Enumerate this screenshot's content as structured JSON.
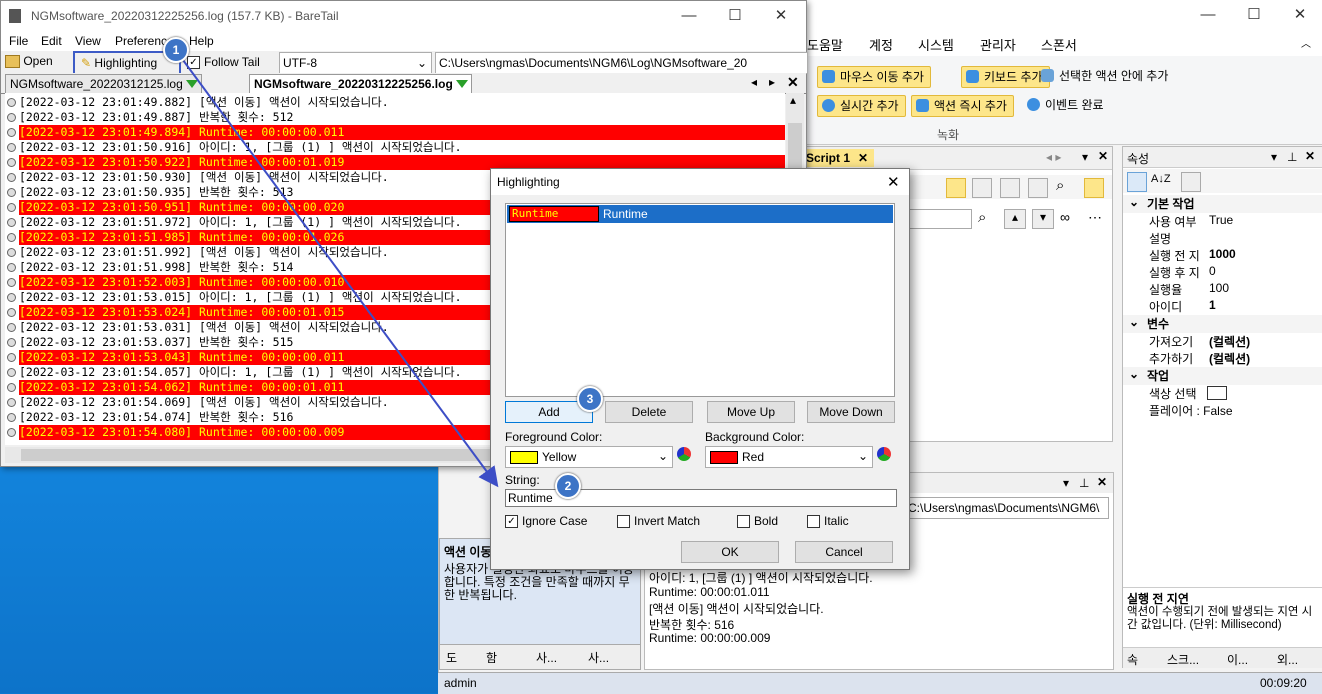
{
  "bt": {
    "title": "NGMsoftware_20220312225256.log (157.7 KB) - BareTail",
    "menu": [
      "File",
      "Edit",
      "View",
      "Preferences",
      "Help"
    ],
    "toolbar": {
      "open": "Open",
      "highlighting": "Highlighting",
      "follow_tail": "Follow Tail",
      "encoding": "UTF-8",
      "path": "C:\\Users\\ngmas\\Documents\\NGM6\\Log\\NGMsoftware_20"
    },
    "tabs": [
      "NGMsoftware_20220312125.log",
      "NGMsoftware_20220312225256.log"
    ],
    "lines": [
      {
        "t": "[2022-03-12 23:01:49.882] [액션 이동] 액션이 시작되었습니다.",
        "hl": false
      },
      {
        "t": "[2022-03-12 23:01:49.887] 반복한 횟수: 512",
        "hl": false
      },
      {
        "t": "[2022-03-12 23:01:49.894] Runtime: 00:00:00.011",
        "hl": true
      },
      {
        "t": "[2022-03-12 23:01:50.916] 아이디: 1, [그룹 (1) ] 액션이 시작되었습니다.",
        "hl": false
      },
      {
        "t": "[2022-03-12 23:01:50.922] Runtime: 00:00:01.019",
        "hl": true
      },
      {
        "t": "[2022-03-12 23:01:50.930] [액션 이동] 액션이 시작되었습니다.",
        "hl": false
      },
      {
        "t": "[2022-03-12 23:01:50.935] 반복한 횟수: 513",
        "hl": false
      },
      {
        "t": "[2022-03-12 23:01:50.951] Runtime: 00:00:00.020",
        "hl": true
      },
      {
        "t": "[2022-03-12 23:01:51.972] 아이디: 1, [그룹 (1) ] 액션이 시작되었습니다.",
        "hl": false
      },
      {
        "t": "[2022-03-12 23:01:51.985] Runtime: 00:00:01.026",
        "hl": true
      },
      {
        "t": "[2022-03-12 23:01:51.992] [액션 이동] 액션이 시작되었습니다.",
        "hl": false
      },
      {
        "t": "[2022-03-12 23:01:51.998] 반복한 횟수: 514",
        "hl": false
      },
      {
        "t": "[2022-03-12 23:01:52.003] Runtime: 00:00:00.010",
        "hl": true
      },
      {
        "t": "[2022-03-12 23:01:53.015] 아이디: 1, [그룹 (1) ] 액션이 시작되었습니다.",
        "hl": false
      },
      {
        "t": "[2022-03-12 23:01:53.024] Runtime: 00:00:01.015",
        "hl": true
      },
      {
        "t": "[2022-03-12 23:01:53.031] [액션 이동] 액션이 시작되었습니다.",
        "hl": false
      },
      {
        "t": "[2022-03-12 23:01:53.037] 반복한 횟수: 515",
        "hl": false
      },
      {
        "t": "[2022-03-12 23:01:53.043] Runtime: 00:00:00.011",
        "hl": true
      },
      {
        "t": "[2022-03-12 23:01:54.057] 아이디: 1, [그룹 (1) ] 액션이 시작되었습니다.",
        "hl": false
      },
      {
        "t": "[2022-03-12 23:01:54.062] Runtime: 00:00:01.011",
        "hl": true
      },
      {
        "t": "[2022-03-12 23:01:54.069] [액션 이동] 액션이 시작되었습니다.",
        "hl": false
      },
      {
        "t": "[2022-03-12 23:01:54.074] 반복한 횟수: 516",
        "hl": false
      },
      {
        "t": "[2022-03-12 23:01:54.080] Runtime: 00:00:00.009",
        "hl": true
      }
    ]
  },
  "dialog": {
    "title": "Highlighting",
    "entry_sample": "Runtime",
    "entry_label": "Runtime",
    "add": "Add",
    "delete": "Delete",
    "move_up": "Move Up",
    "move_down": "Move Down",
    "fg_label": "Foreground Color:",
    "fg_value": "Yellow",
    "fg_color": "#ffff00",
    "bg_label": "Background Color:",
    "bg_value": "Red",
    "bg_color": "#ff0000",
    "string_label": "String:",
    "string_value": "Runtime",
    "ignore_case": "Ignore Case",
    "invert_match": "Invert Match",
    "bold": "Bold",
    "italic": "Italic",
    "ok": "OK",
    "cancel": "Cancel"
  },
  "badges": [
    "1",
    "2",
    "3"
  ],
  "bgapp": {
    "menu": [
      "도움말",
      "계정",
      "시스템",
      "관리자",
      "스폰서"
    ],
    "ribbon": {
      "mouse": "마우스 이동 추가",
      "keyboard": "키보드 추가",
      "selected": "선택한 액션 안에 추가",
      "realtime": "실시간 추가",
      "instant": "액션 즉시 추가",
      "event": "이벤트 완료",
      "group": "녹화"
    },
    "script_tab": "Script 1",
    "props_title": "속성",
    "props": {
      "cat1": "기본 작업",
      "rows1": [
        [
          "사용 여부",
          "True"
        ],
        [
          "설명",
          ""
        ],
        [
          "실행 전 지",
          "1000"
        ],
        [
          "실행 후 지",
          "0"
        ],
        [
          "실행율",
          "100"
        ],
        [
          "아이디",
          "1"
        ]
      ],
      "cat2": "변수",
      "rows2": [
        [
          "가져오기",
          "(컬렉션)"
        ],
        [
          "추가하기",
          "(컬렉션)"
        ]
      ],
      "cat3": "작업",
      "rows3": [
        [
          "색상 선택",
          ""
        ],
        [
          "플레이어 : False",
          ""
        ]
      ]
    },
    "help_title": "실행 전 지연",
    "help_text": "액션이 수행되기 전에 발생되는 지연 시간 값입니다. (단위: Millisecond)",
    "left_title": "액션 이동",
    "left_text": "사용자가 설정한 좌표로 마우스를 이동합니다. 특정 조건을 만족할 때까지 무한 반복됩니다.",
    "output_path": "C:\\Users\\ngmas\\Documents\\NGM6\\",
    "output_lines": [
      "아이디: 1, [그룹 (1) ] 액션이 시작되었습니다.",
      "Runtime: 00:00:01.011",
      "[액션 이동] 액션이 시작되었습니다.",
      "반복한 횟수: 516",
      "Runtime: 00:00:00.009"
    ],
    "bottom_tabs": [
      "도",
      "함",
      "사...",
      "사..."
    ],
    "right_tabs": [
      "속",
      "스크...",
      "이...",
      "외..."
    ],
    "status_user": "admin",
    "status_time": "00:09:20"
  }
}
